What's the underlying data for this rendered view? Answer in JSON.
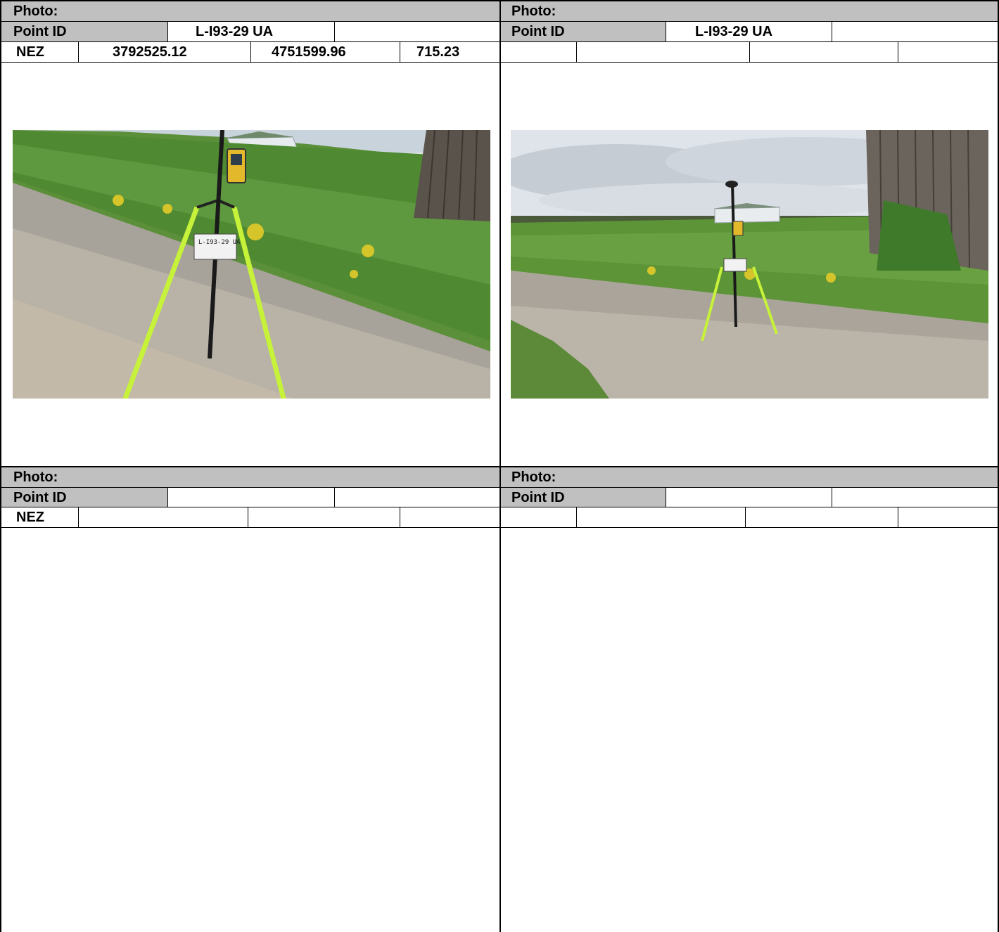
{
  "form": {
    "photo_label": "Photo:",
    "point_id_label": "Point ID",
    "nez_label": "NEZ"
  },
  "cells": [
    {
      "position": "top-left",
      "point_id": "L-I93-29 UA",
      "nez": {
        "n": "3792525.12",
        "e": "4751599.96",
        "z": "715.23"
      },
      "has_photo": true,
      "photo_description": "GPS receiver on a tripod over a gravel road, grassy slope and barn behind",
      "sign_text": "L-I93-29 UA"
    },
    {
      "position": "top-right",
      "point_id": "L-I93-29 UA",
      "nez": {
        "n": "",
        "e": "",
        "z": ""
      },
      "has_photo": true,
      "photo_description": "Wider view of the GPS tripod on the gravel road with a barn at right and a shed in the distance"
    },
    {
      "position": "bottom-left",
      "point_id": "",
      "nez": {
        "n": "",
        "e": "",
        "z": ""
      },
      "has_photo": false
    },
    {
      "position": "bottom-right",
      "point_id": "",
      "nez": {
        "n": "",
        "e": "",
        "z": ""
      },
      "has_photo": false
    }
  ],
  "colors": {
    "header_fill": "#c0c0c0",
    "grid_line": "#000000"
  }
}
